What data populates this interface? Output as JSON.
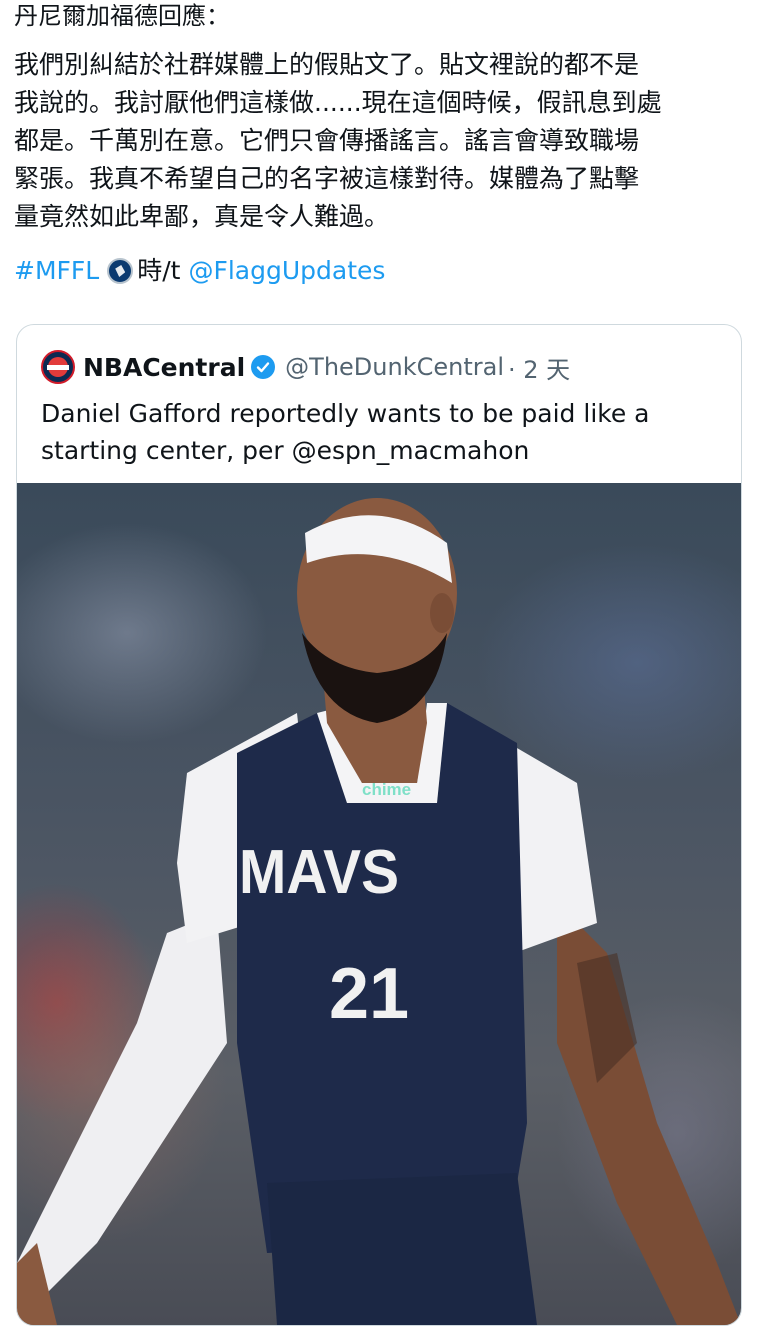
{
  "post": {
    "header": "丹尼爾加福德回應：",
    "body": "我們別糾結於社群媒體上的假貼文了。貼文裡說的都不是\n我說的。我討厭他們這樣做......現在這個時候，假訊息到處\n都是。千萬別在意。它們只會傳播謠言。謠言會導致職場\n緊張。我真不希望自己的名字被這樣對待。媒體為了點擊\n量竟然如此卑鄙，真是令人難過。",
    "hashtag": "#MFFL",
    "logo_icon": "mavs-logo-icon",
    "hat_tip": "時/t",
    "mention": "@FlaggUpdates"
  },
  "quote": {
    "name": "NBACentral",
    "handle": "@TheDunkCentral",
    "time": "· 2 天",
    "text": "Daniel Gafford reportedly wants to be paid like a\nstarting center, per @espn_macmahon",
    "image_jersey_text": "MAVS",
    "image_jersey_number": "21",
    "image_sponsor": "chime"
  },
  "colors": {
    "link": "#1d9bf0",
    "jersey": "#1e2a4a",
    "verified": "#1d9bf0"
  }
}
